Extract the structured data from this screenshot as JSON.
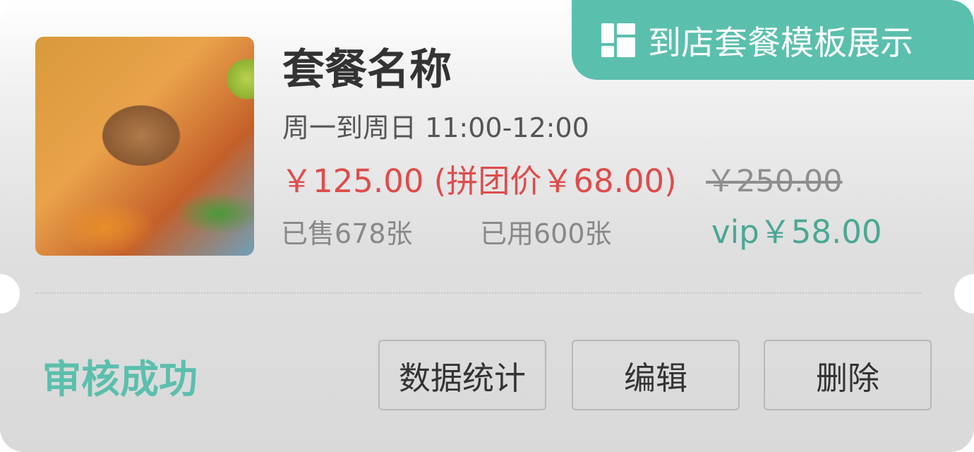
{
  "badge": {
    "label": "到店套餐模板展示",
    "icon": "grid-icon"
  },
  "package": {
    "name": "套餐名称",
    "time": "周一到周日 11:00-12:00",
    "price": "￥125.00 (拼团价￥68.00)",
    "original_price": "￥250.00",
    "sold": "已售678张",
    "used": "已用600张",
    "vip_price": "vip￥58.00"
  },
  "status": "审核成功",
  "actions": {
    "stats": "数据统计",
    "edit": "编辑",
    "delete": "删除"
  },
  "colors": {
    "accent": "#5bbfad",
    "price": "#de4c4c",
    "vip": "#4aa894"
  }
}
